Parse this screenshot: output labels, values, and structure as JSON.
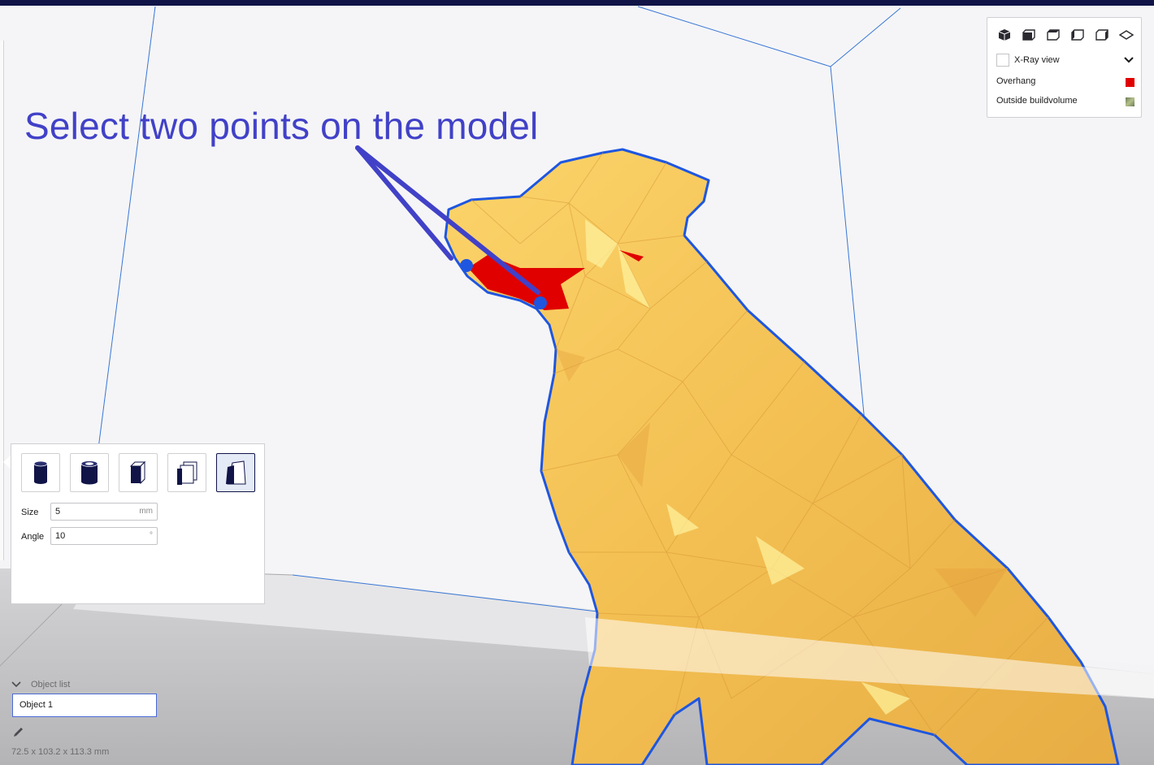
{
  "annotation": {
    "text": "Select two points on the model"
  },
  "view_panel": {
    "camera_icons": [
      "3d-view-icon",
      "front-view-icon",
      "top-view-icon",
      "left-view-icon",
      "right-view-icon",
      "perspective-toggle-icon"
    ],
    "xray_label": "X-Ray view",
    "legend": [
      {
        "label": "Overhang",
        "color": "#e00000"
      },
      {
        "label": "Outside buildvolume",
        "color": "#8a9a70"
      }
    ]
  },
  "support_tool": {
    "shapes": [
      {
        "name": "cylinder",
        "active": false
      },
      {
        "name": "tube",
        "active": false
      },
      {
        "name": "cube",
        "active": false
      },
      {
        "name": "abutment",
        "active": false
      },
      {
        "name": "line",
        "active": true
      }
    ],
    "size": {
      "label": "Size",
      "value": "5",
      "unit": "mm"
    },
    "angle": {
      "label": "Angle",
      "value": "10",
      "unit": "°"
    }
  },
  "object_list": {
    "header": "Object list",
    "selected_object": "Object 1",
    "dimensions": "72.5 x 103.2 x 113.3 mm"
  },
  "colors": {
    "accent": "#101447",
    "annotation": "#4141c8",
    "model_fill": "#f5c452",
    "model_outline": "#1e56e0",
    "overhang": "#e00000"
  }
}
